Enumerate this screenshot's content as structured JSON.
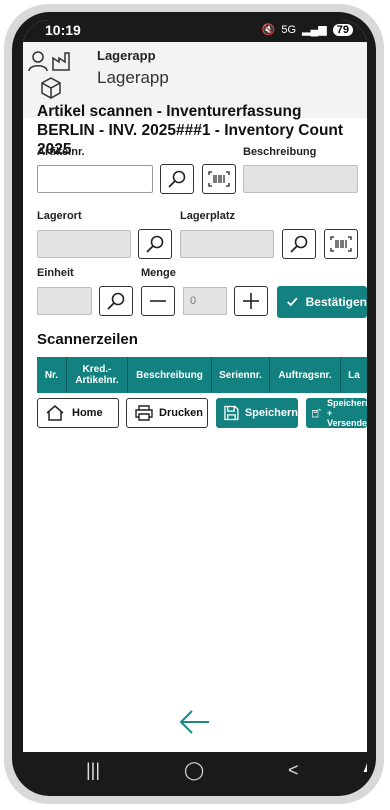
{
  "statusbar": {
    "time": "10:19",
    "indicators": "5G",
    "battery": "79"
  },
  "header": {
    "app_name_small": "Lagerapp",
    "app_name_large": "Lagerapp"
  },
  "page": {
    "title": "Artikel scannen - Inventurerfassung BERLIN - INV. 2025###1 - Inventory Count 2025"
  },
  "form": {
    "artikelnr_label": "Artikelnr.",
    "beschreibung_label": "Beschreibung",
    "lagerort_label": "Lagerort",
    "lagerplatz_label": "Lagerplatz",
    "einheit_label": "Einheit",
    "menge_label": "Menge",
    "menge_value": "0",
    "confirm_label": "Bestätigen"
  },
  "scanner": {
    "section_title": "Scannerzeilen",
    "columns": [
      "Nr.",
      "Kred.-Artikelnr.",
      "Beschreibung",
      "Seriennr.",
      "Auftragsnr.",
      "La"
    ]
  },
  "actions": {
    "home_label": "Home",
    "print_label": "Drucken",
    "save_label": "Speichern",
    "save_send_label": "Speichern + Versenden"
  },
  "colors": {
    "accent": "#12817f",
    "disabled_field": "#e3e3e3"
  }
}
